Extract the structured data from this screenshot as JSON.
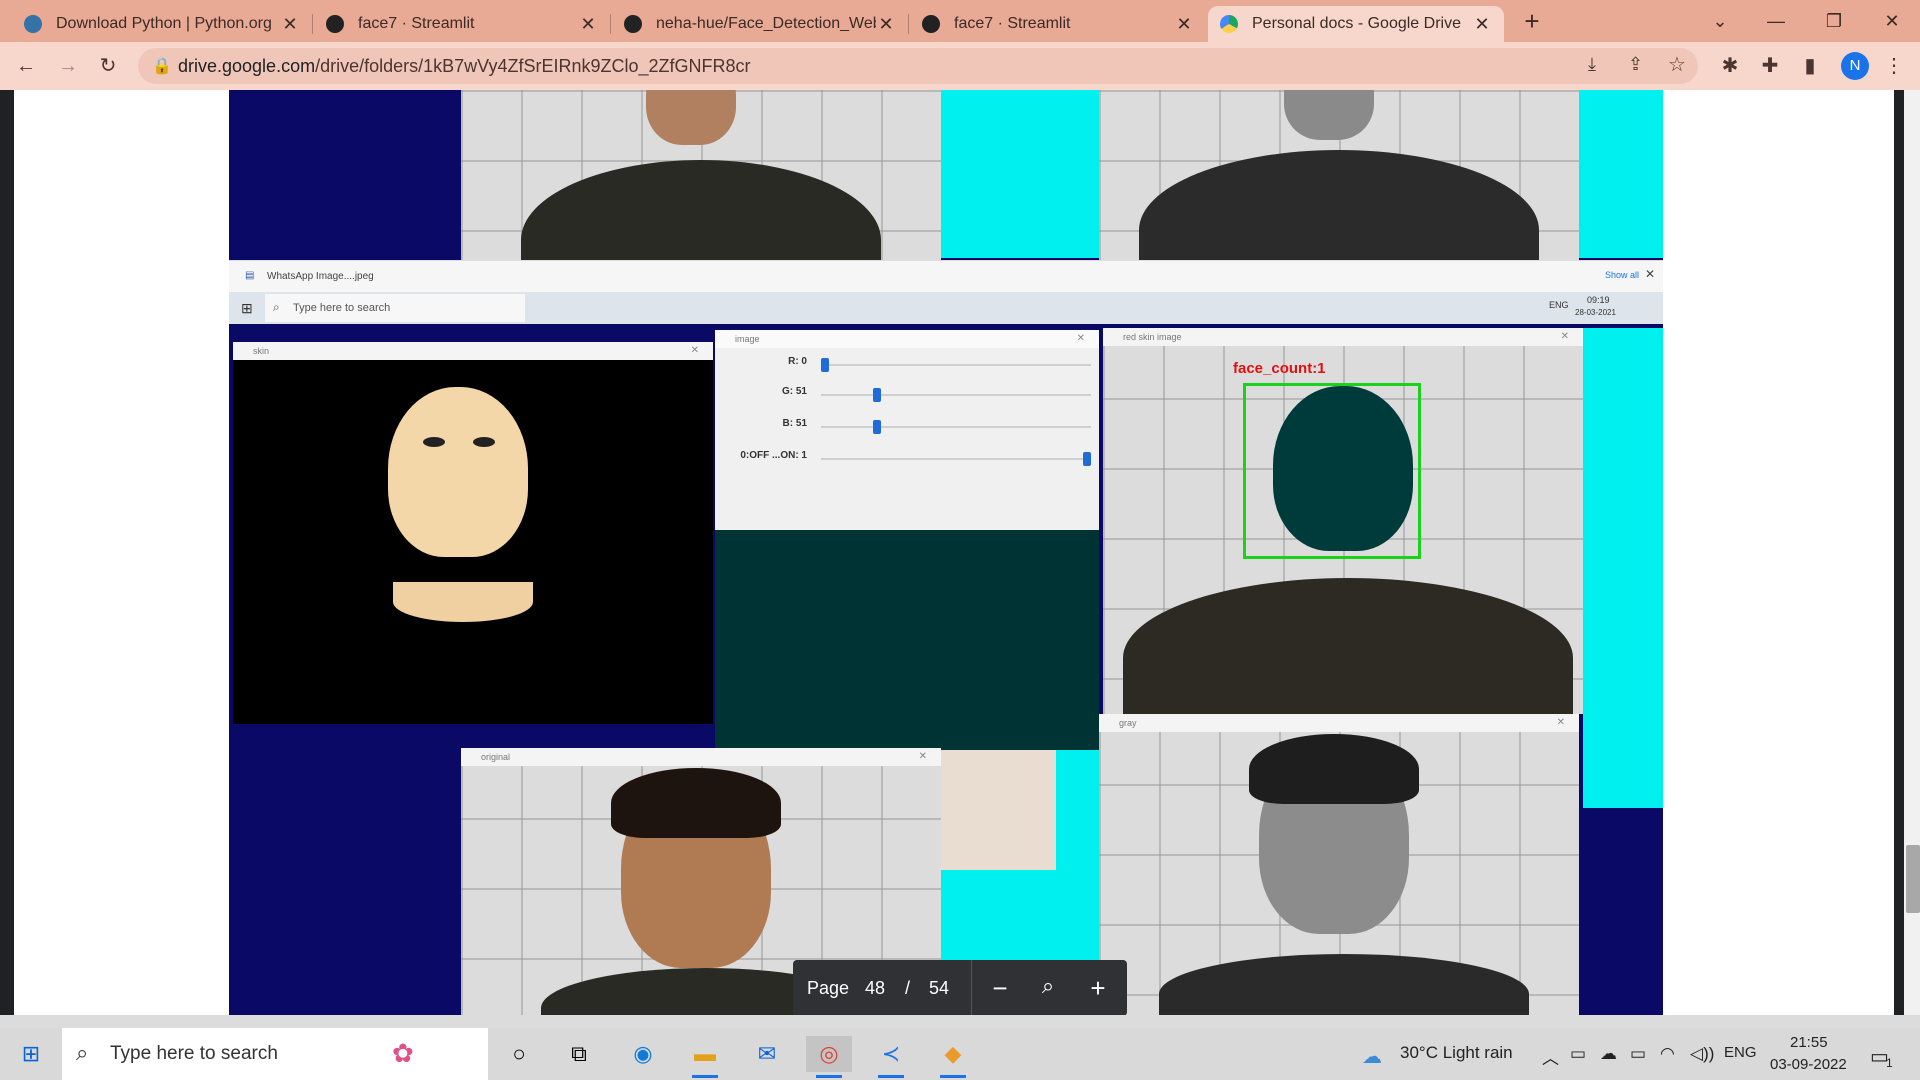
{
  "browser": {
    "tabs": [
      {
        "title": "Download Python | Python.org",
        "active": false,
        "favicon": "python-icon",
        "color": "#3572A5"
      },
      {
        "title": "face7 · Streamlit",
        "active": false,
        "favicon": "streamlit-icon",
        "color": "#222222"
      },
      {
        "title": "neha-hue/Face_Detection_WebA",
        "active": false,
        "favicon": "github-icon",
        "color": "#222222"
      },
      {
        "title": "face7 · Streamlit",
        "active": false,
        "favicon": "streamlit-icon",
        "color": "#222222"
      },
      {
        "title": "Personal docs - Google Drive",
        "active": true,
        "favicon": "google-drive-icon",
        "color": "#1fa463"
      }
    ],
    "new_tab": "+",
    "url_host": "drive.google.com",
    "url_path": "/drive/folders/1kB7wVy4ZfSrEIRnk9ZClo_2ZfGNFR8cr",
    "profile_initial": "N"
  },
  "embedded": {
    "download_file": "WhatsApp Image....jpeg",
    "show_all": "Show all",
    "inner_taskbar_search": "Type here to search",
    "inner_clock_time": "09:19",
    "inner_clock_date": "28-03-2021",
    "inner_lang": "ENG",
    "windows": {
      "skin": "skin",
      "image": "image",
      "red_skin": "red skin image",
      "gray": "gray",
      "original": "original"
    },
    "face_count": "face_count:1",
    "sliders": [
      {
        "label": "R: 0",
        "value": 0,
        "max": 255
      },
      {
        "label": "G: 51",
        "value": 51,
        "max": 255
      },
      {
        "label": "B: 51",
        "value": 51,
        "max": 255
      },
      {
        "label": "0:OFF ...ON: 1",
        "value": 1,
        "max": 1
      }
    ],
    "panel_color": "#003333"
  },
  "viewer": {
    "page_label": "Page",
    "current_page": "48",
    "separator": "/",
    "total_pages": "54"
  },
  "taskbar": {
    "search_placeholder": "Type here to search",
    "weather": "30°C  Light rain",
    "lang": "ENG",
    "time": "21:55",
    "date": "03-09-2022",
    "notifications": "1"
  }
}
